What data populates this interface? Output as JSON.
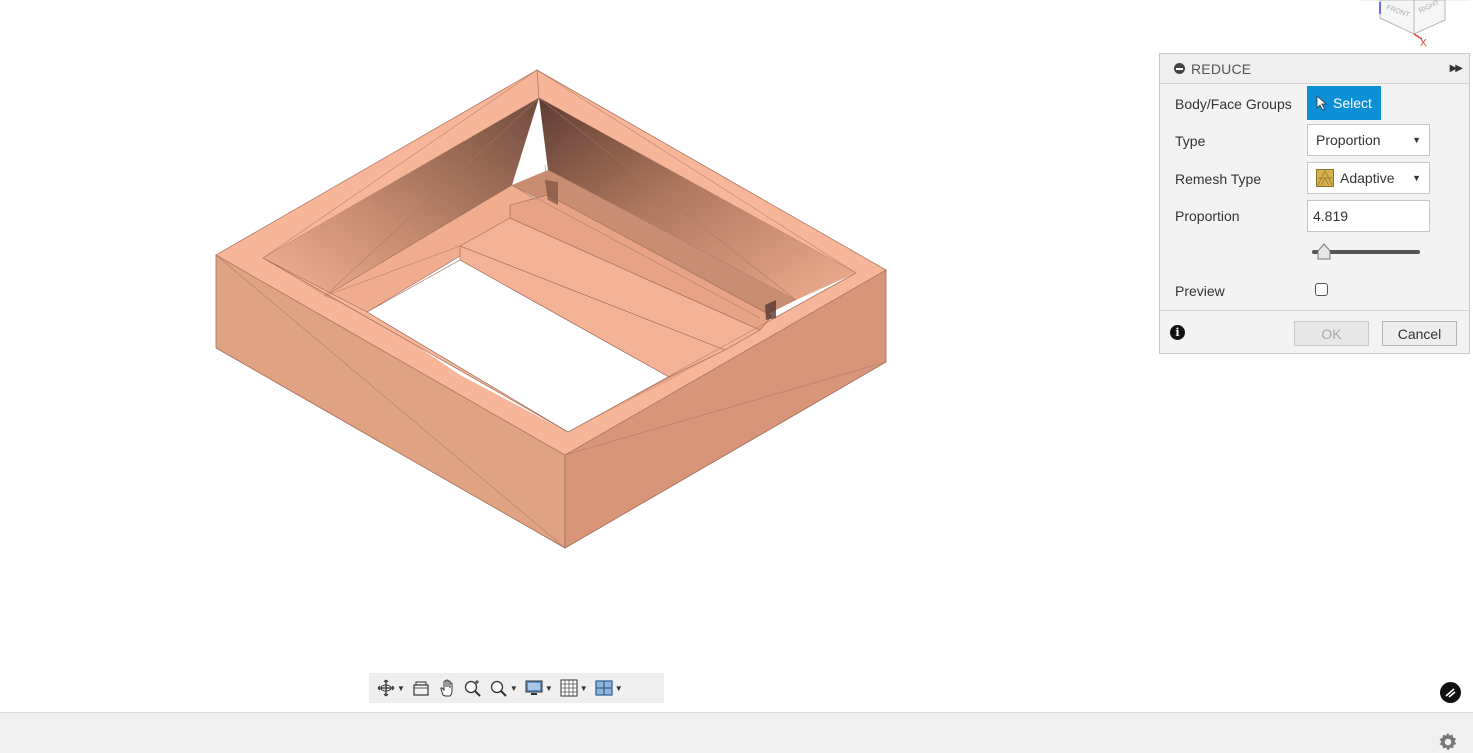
{
  "viewcube": {
    "face_front": "FRONT",
    "face_right": "RIGHT",
    "axis_x": "X"
  },
  "dialog": {
    "title": "REDUCE",
    "collapse_icon": "minus-circle-icon",
    "expand_icon": "double-chevron-right-icon",
    "body_face_label": "Body/Face Groups",
    "select_label": "Select",
    "type_label": "Type",
    "type_value": "Proportion",
    "remesh_label": "Remesh Type",
    "remesh_value": "Adaptive",
    "proportion_label": "Proportion",
    "proportion_value": "4.819",
    "slider_value_fraction": 0.05,
    "preview_label": "Preview",
    "preview_checked": false,
    "ok_label": "OK",
    "ok_enabled": false,
    "cancel_label": "Cancel",
    "info_icon": "info-icon"
  },
  "toolbar": {
    "items": [
      "orbit-icon",
      "look-at-icon",
      "pan-icon",
      "zoom-icon",
      "zoom-window-icon",
      "display-settings-icon",
      "grid-settings-icon",
      "viewports-icon"
    ]
  },
  "colors": {
    "model_top": "#f7b699",
    "model_side_left": "#dfa283",
    "model_side_right": "#d89579",
    "select_accent": "#0b8fd6"
  }
}
